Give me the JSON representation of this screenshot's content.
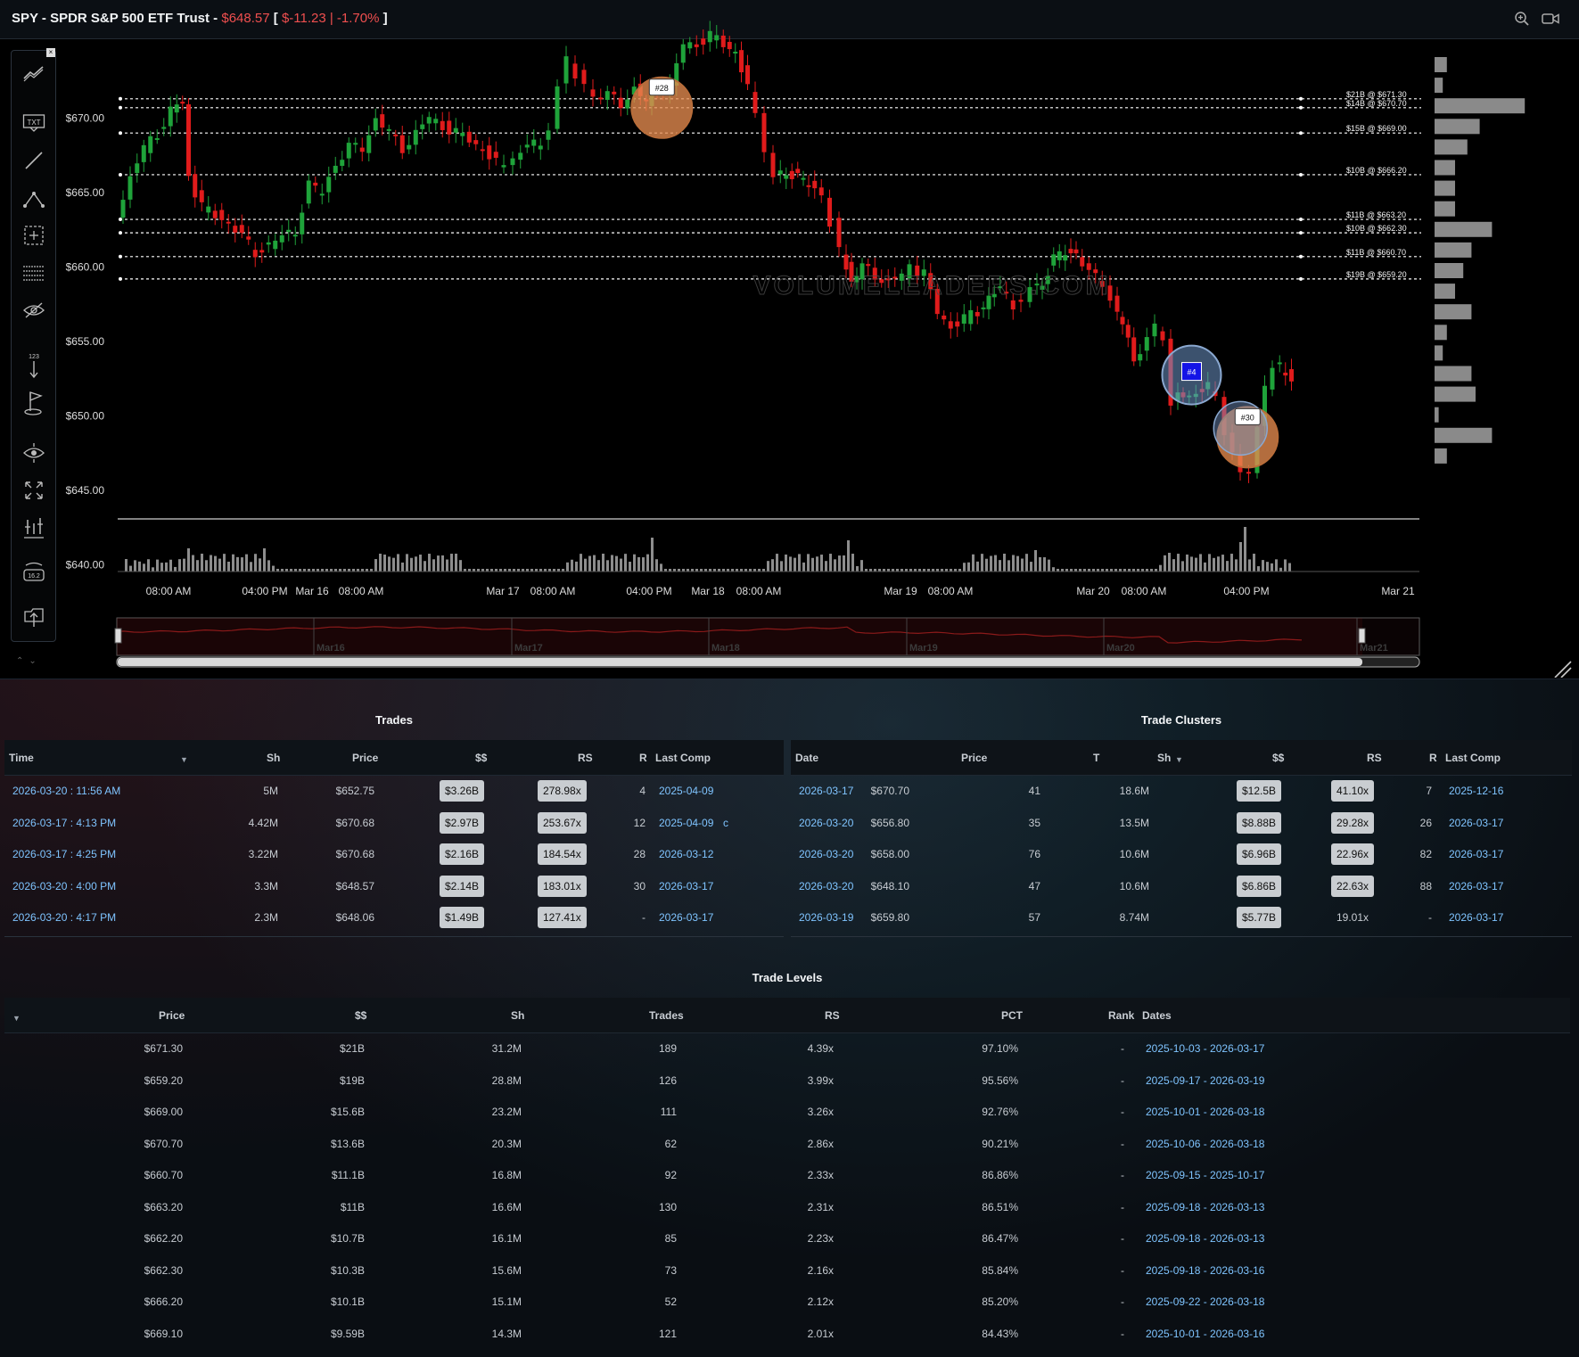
{
  "header": {
    "symbol": "SPY - SPDR S&P 500 ETF Trust - ",
    "price": "$648.57",
    "bracket_open": " [ ",
    "change": "$-11.23 | -1.70%",
    "bracket_close": " ]",
    "zoom_icon": "zoom-icon",
    "record_icon": "video-camera-icon"
  },
  "colors": {
    "up": "#1fa33a",
    "down": "#e01b1b",
    "link": "#7fc4ff",
    "negative": "#ef4f4f",
    "level_line": "#ffffff",
    "profile_bar": "#8a8a8a"
  },
  "toolbar": {
    "icons": [
      "trend-lines-icon",
      "text-annotation-icon",
      "line-draw-icon",
      "abc-pattern-icon",
      "selection-box-icon",
      "horizontal-lines-icon",
      "hide-drawings-icon",
      "price-marker-icon",
      "flag-icon",
      "crosshair-zoom-icon",
      "fullscreen-icon",
      "adjust-bars-icon",
      "price-label-icon",
      "export-chart-icon"
    ],
    "txt_label": "TXT"
  },
  "chart": {
    "watermark": "VOLUMELEADERS.COM",
    "y_ticks": [
      "$670.00",
      "$665.00",
      "$660.00",
      "$655.00",
      "$650.00",
      "$645.00",
      "$640.00"
    ],
    "x_ticks": [
      "08:00 AM",
      "04:00 PM",
      "Mar 16",
      "08:00 AM",
      "Mar 17",
      "08:00 AM",
      "04:00 PM",
      "Mar 18",
      "08:00 AM",
      "Mar 19",
      "08:00 AM",
      "Mar 20",
      "08:00 AM",
      "04:00 PM",
      "Mar 21"
    ],
    "navigator_labels": [
      "Mar16",
      "Mar17",
      "Mar18",
      "Mar19",
      "Mar20",
      "Mar21"
    ],
    "level_labels": [
      {
        "text": "$21B @ $671.30",
        "price": 671.3
      },
      {
        "text": "$14B @ $670.70",
        "price": 670.7
      },
      {
        "text": "$15B @ $669.00",
        "price": 669.0
      },
      {
        "text": "$10B @ $666.20",
        "price": 666.2
      },
      {
        "text": "$11B @ $663.20",
        "price": 663.2
      },
      {
        "text": "$10B @ $662.30",
        "price": 662.3
      },
      {
        "text": "$11B @ $660.70",
        "price": 660.7
      },
      {
        "text": "$19B @ $659.20",
        "price": 659.2
      }
    ],
    "bubbles": [
      {
        "label": "#28",
        "price": 670.7,
        "x_frac": 0.418,
        "kind": "orange"
      },
      {
        "label": "#4",
        "price": 652.75,
        "x_frac": 0.825,
        "kind": "blue"
      },
      {
        "label": "#30",
        "price": 648.57,
        "x_frac": 0.868,
        "kind": "orange"
      }
    ],
    "volume_profile": [
      3,
      2,
      22,
      11,
      8,
      5,
      5,
      5,
      14,
      9,
      7,
      5,
      9,
      3,
      2,
      9,
      10,
      1,
      14,
      3
    ]
  },
  "trades": {
    "title": "Trades",
    "columns": [
      "Time",
      "Sh",
      "Price",
      "$$",
      "RS",
      "R",
      "Last Comp"
    ],
    "rows": [
      {
        "time": "2026-03-20 : 11:56 AM",
        "sh": "5M",
        "price": "$652.75",
        "dollars": "$3.26B",
        "rs": "278.98x",
        "r": "4",
        "last": "2025-04-09",
        "extra": ""
      },
      {
        "time": "2026-03-17 : 4:13 PM",
        "sh": "4.42M",
        "price": "$670.68",
        "dollars": "$2.97B",
        "rs": "253.67x",
        "r": "12",
        "last": "2025-04-09",
        "extra": "c"
      },
      {
        "time": "2026-03-17 : 4:25 PM",
        "sh": "3.22M",
        "price": "$670.68",
        "dollars": "$2.16B",
        "rs": "184.54x",
        "r": "28",
        "last": "2026-03-12",
        "extra": ""
      },
      {
        "time": "2026-03-20 : 4:00 PM",
        "sh": "3.3M",
        "price": "$648.57",
        "dollars": "$2.14B",
        "rs": "183.01x",
        "r": "30",
        "last": "2026-03-17",
        "extra": ""
      },
      {
        "time": "2026-03-20 : 4:17 PM",
        "sh": "2.3M",
        "price": "$648.06",
        "dollars": "$1.49B",
        "rs": "127.41x",
        "r": "-",
        "last": "2026-03-17",
        "extra": ""
      }
    ]
  },
  "clusters": {
    "title": "Trade Clusters",
    "columns": [
      "Date",
      "Price",
      "T",
      "Sh",
      "$$",
      "RS",
      "R",
      "Last Comp"
    ],
    "rows": [
      {
        "date": "2026-03-17",
        "price": "$670.70",
        "t": "41",
        "sh": "18.6M",
        "dollars": "$12.5B",
        "rs": "41.10x",
        "rs_badge": true,
        "r": "7",
        "last": "2025-12-16"
      },
      {
        "date": "2026-03-20",
        "price": "$656.80",
        "t": "35",
        "sh": "13.5M",
        "dollars": "$8.88B",
        "rs": "29.28x",
        "rs_badge": true,
        "r": "26",
        "last": "2026-03-17"
      },
      {
        "date": "2026-03-20",
        "price": "$658.00",
        "t": "76",
        "sh": "10.6M",
        "dollars": "$6.96B",
        "rs": "22.96x",
        "rs_badge": true,
        "r": "82",
        "last": "2026-03-17"
      },
      {
        "date": "2026-03-20",
        "price": "$648.10",
        "t": "47",
        "sh": "10.6M",
        "dollars": "$6.86B",
        "rs": "22.63x",
        "rs_badge": true,
        "r": "88",
        "last": "2026-03-17"
      },
      {
        "date": "2026-03-19",
        "price": "$659.80",
        "t": "57",
        "sh": "8.74M",
        "dollars": "$5.77B",
        "rs": "19.01x",
        "rs_badge": false,
        "r": "-",
        "last": "2026-03-17"
      }
    ]
  },
  "levels": {
    "title": "Trade Levels",
    "columns": [
      "Price",
      "$$",
      "Sh",
      "Trades",
      "RS",
      "PCT",
      "Rank",
      "Dates"
    ],
    "rows": [
      {
        "price": "$671.30",
        "dollars": "$21B",
        "sh": "31.2M",
        "trades": "189",
        "rs": "4.39x",
        "pct": "97.10%",
        "rank": "-",
        "dates": "2025-10-03 - 2026-03-17"
      },
      {
        "price": "$659.20",
        "dollars": "$19B",
        "sh": "28.8M",
        "trades": "126",
        "rs": "3.99x",
        "pct": "95.56%",
        "rank": "-",
        "dates": "2025-09-17 - 2026-03-19"
      },
      {
        "price": "$669.00",
        "dollars": "$15.6B",
        "sh": "23.2M",
        "trades": "111",
        "rs": "3.26x",
        "pct": "92.76%",
        "rank": "-",
        "dates": "2025-10-01 - 2026-03-18"
      },
      {
        "price": "$670.70",
        "dollars": "$13.6B",
        "sh": "20.3M",
        "trades": "62",
        "rs": "2.86x",
        "pct": "90.21%",
        "rank": "-",
        "dates": "2025-10-06 - 2026-03-18"
      },
      {
        "price": "$660.70",
        "dollars": "$11.1B",
        "sh": "16.8M",
        "trades": "92",
        "rs": "2.33x",
        "pct": "86.86%",
        "rank": "-",
        "dates": "2025-09-15 - 2025-10-17"
      },
      {
        "price": "$663.20",
        "dollars": "$11B",
        "sh": "16.6M",
        "trades": "130",
        "rs": "2.31x",
        "pct": "86.51%",
        "rank": "-",
        "dates": "2025-09-18 - 2026-03-13"
      },
      {
        "price": "$662.20",
        "dollars": "$10.7B",
        "sh": "16.1M",
        "trades": "85",
        "rs": "2.23x",
        "pct": "86.47%",
        "rank": "-",
        "dates": "2025-09-18 - 2026-03-13"
      },
      {
        "price": "$662.30",
        "dollars": "$10.3B",
        "sh": "15.6M",
        "trades": "73",
        "rs": "2.16x",
        "pct": "85.84%",
        "rank": "-",
        "dates": "2025-09-18 - 2026-03-16"
      },
      {
        "price": "$666.20",
        "dollars": "$10.1B",
        "sh": "15.1M",
        "trades": "52",
        "rs": "2.12x",
        "pct": "85.20%",
        "rank": "-",
        "dates": "2025-09-22 - 2026-03-18"
      },
      {
        "price": "$669.10",
        "dollars": "$9.59B",
        "sh": "14.3M",
        "trades": "121",
        "rs": "2.01x",
        "pct": "84.43%",
        "rank": "-",
        "dates": "2025-10-01 - 2026-03-16"
      }
    ]
  }
}
